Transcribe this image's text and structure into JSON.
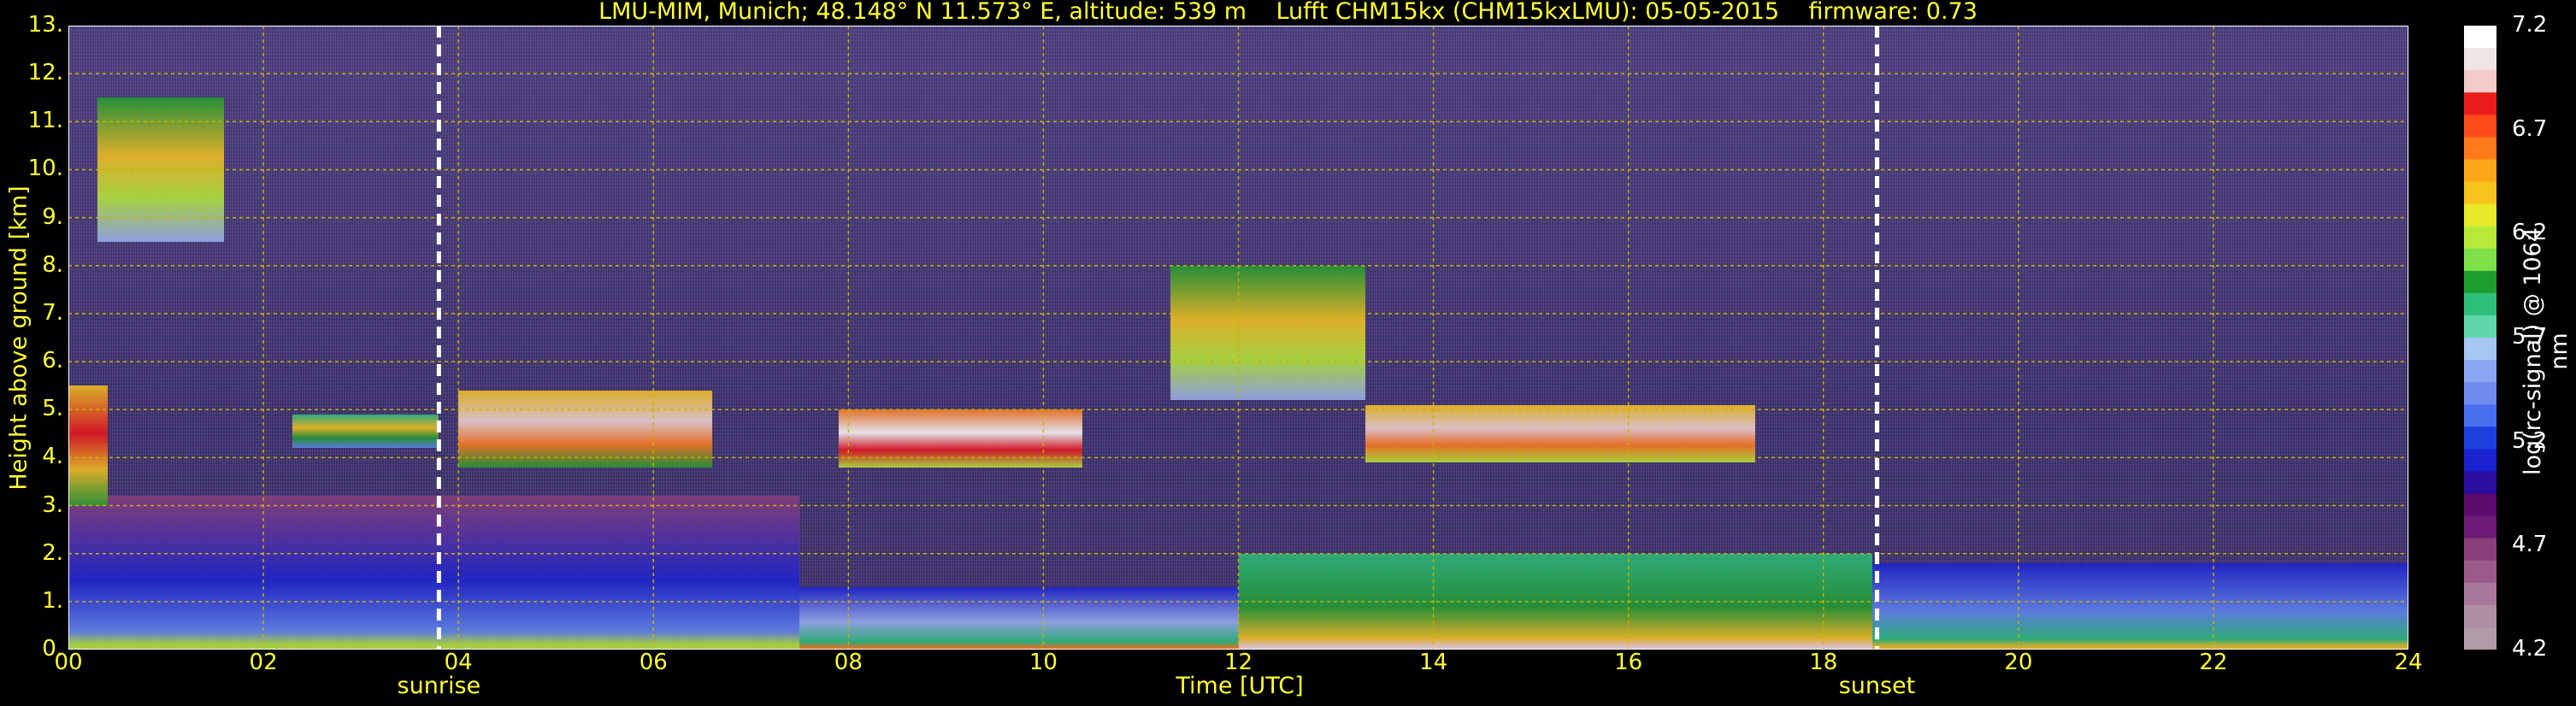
{
  "chart_data": {
    "type": "heatmap",
    "title": "LMU-MIM, Munich; 48.148° N 11.573° E, altitude: 539 m    Lufft CHM15kx (CHM15kxLMU): 05-05-2015    firmware: 0.73",
    "xlabel": "Time [UTC]",
    "ylabel": "Height above ground [km]",
    "xlim": [
      0,
      24
    ],
    "ylim": [
      0,
      13
    ],
    "x_ticks": [
      "00",
      "02",
      "04",
      "06",
      "08",
      "10",
      "12",
      "14",
      "16",
      "18",
      "20",
      "22",
      "24"
    ],
    "y_ticks": [
      "0.",
      "1.",
      "2.",
      "3.",
      "4.",
      "5.",
      "6.",
      "7.",
      "8.",
      "9.",
      "10.",
      "11.",
      "12.",
      "13."
    ],
    "grid": true,
    "events": [
      {
        "label": "sunrise",
        "time": 3.8
      },
      {
        "label": "sunset",
        "time": 18.55
      }
    ],
    "colorbar": {
      "label": "log(rc-signal) @ 1064 nm",
      "min": 4.2,
      "max": 7.2,
      "ticks": [
        "7.2",
        "6.7",
        "6.2",
        "5.7",
        "5.2",
        "4.7",
        "4.2"
      ]
    },
    "cloud_layers": [
      {
        "t0": 0.0,
        "t1": 0.4,
        "z0": 3.0,
        "z1": 5.5,
        "level": 6.9
      },
      {
        "t0": 2.3,
        "t1": 3.8,
        "z0": 4.2,
        "z1": 4.9,
        "level": 6.3
      },
      {
        "t0": 4.0,
        "t1": 6.6,
        "z0": 3.8,
        "z1": 5.4,
        "level": 7.0
      },
      {
        "t0": 7.9,
        "t1": 10.4,
        "z0": 3.8,
        "z1": 5.0,
        "level": 7.2
      },
      {
        "t0": 13.3,
        "t1": 17.3,
        "z0": 3.9,
        "z1": 5.1,
        "level": 7.1
      },
      {
        "t0": 0.3,
        "t1": 1.6,
        "z0": 8.5,
        "z1": 11.5,
        "level": 6.5
      },
      {
        "t0": 11.3,
        "t1": 13.3,
        "z0": 5.2,
        "z1": 8.0,
        "level": 6.5
      }
    ],
    "boundary_layer": [
      {
        "t0": 0.0,
        "t1": 7.5,
        "z0": 0.0,
        "z1": 3.2,
        "level": 4.9
      },
      {
        "t0": 7.5,
        "t1": 12.0,
        "z0": 0.0,
        "z1": 1.3,
        "level": 5.4
      },
      {
        "t0": 12.0,
        "t1": 18.5,
        "z0": 0.0,
        "z1": 2.0,
        "level": 5.9
      },
      {
        "t0": 18.5,
        "t1": 24.0,
        "z0": 0.0,
        "z1": 1.8,
        "level": 5.3
      }
    ]
  }
}
